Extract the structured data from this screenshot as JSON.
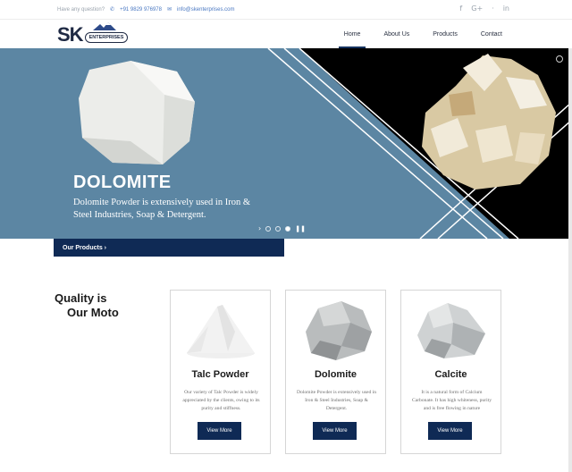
{
  "topbar": {
    "question": "Have any question?",
    "phone": "+91 9829 976978",
    "email": "info@skenterprises.com",
    "social": [
      "f",
      "G+",
      "·",
      "in"
    ]
  },
  "logo": {
    "text": "SK",
    "subtext": "ENTERPRISES"
  },
  "nav": {
    "items": [
      {
        "label": "Home",
        "active": true
      },
      {
        "label": "About Us",
        "active": false
      },
      {
        "label": "Products",
        "active": false
      },
      {
        "label": "Contact",
        "active": false
      }
    ]
  },
  "hero": {
    "title": "DOLOMITE",
    "subtitle": "Dolomite Powder is extensively used in Iron & Steel Industries, Soap & Detergent.",
    "slides_total": 4,
    "active_slide": 3,
    "colors": {
      "panel": "#5c86a3",
      "dark": "#000000"
    }
  },
  "products_bar": {
    "label": "Our Products ›"
  },
  "quality": {
    "line1": "Quality is",
    "line2": "Our Moto"
  },
  "cards": [
    {
      "title": "Talc Powder",
      "desc": "Our variety of Talc Powder is widely appreciated by the clients, owing to its purity and stiffness.",
      "button": "View More",
      "icon": "talc-powder-image"
    },
    {
      "title": "Dolomite",
      "desc": "Dolomite Powder is extensively used in Iron & Steel Industries, Soap & Detergent.",
      "button": "View More",
      "icon": "dolomite-rock-image"
    },
    {
      "title": "Calcite",
      "desc": "It is a natural form of Calcium Carbonate. It has high whiteness, purity and is free flowing in nature",
      "button": "View More",
      "icon": "calcite-rock-image"
    }
  ],
  "accent": "#0f2a55"
}
